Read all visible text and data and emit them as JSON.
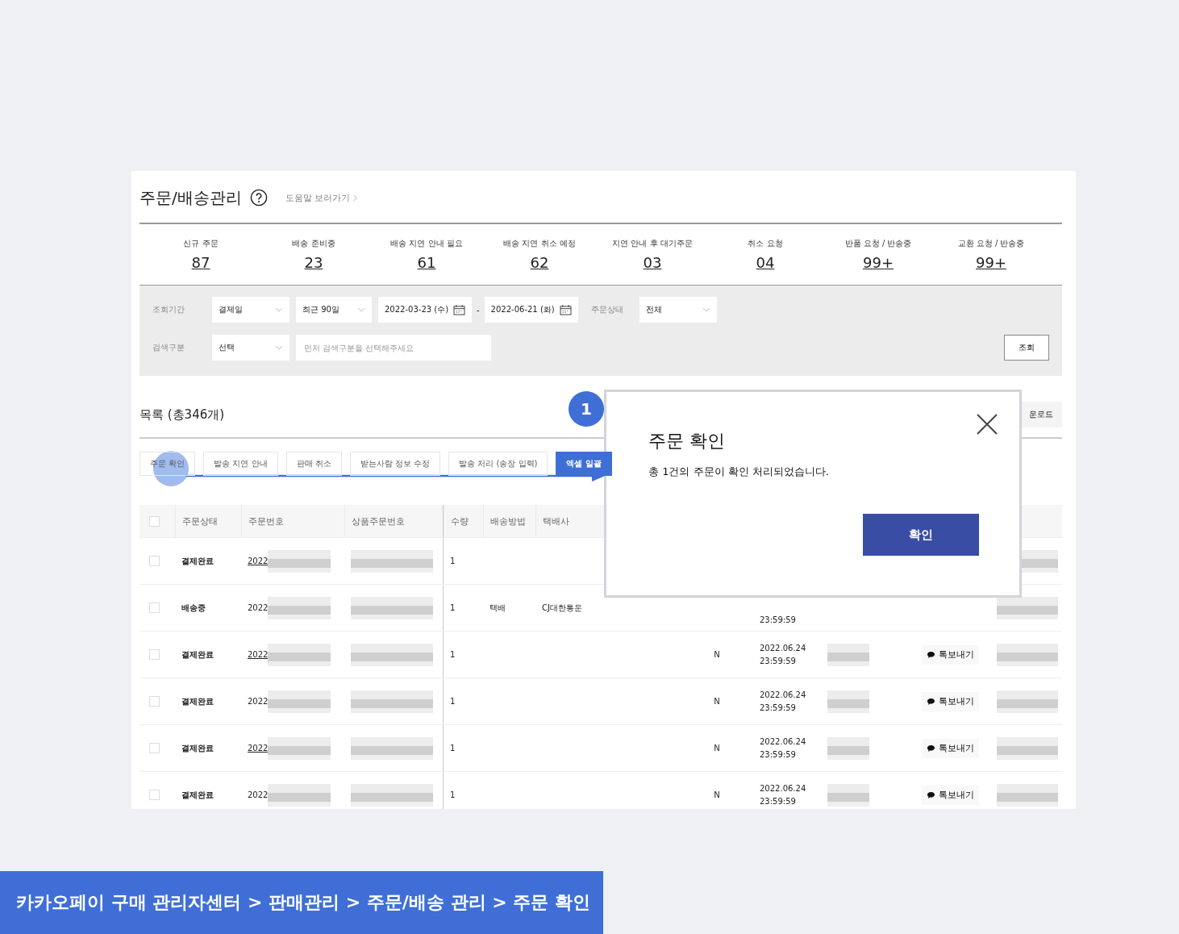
{
  "page": {
    "title": "주문/배송관리",
    "help_link": "도움말 보러가기"
  },
  "stats": [
    {
      "label": "신규 주문",
      "value": "87"
    },
    {
      "label": "배송 준비중",
      "value": "23"
    },
    {
      "label": "배송 지연 안내 필요",
      "value": "61"
    },
    {
      "label": "배송 지연 취소 예정",
      "value": "62"
    },
    {
      "label": "지연 안내 후 대기주문",
      "value": "03"
    },
    {
      "label": "취소 요청",
      "value": "04"
    },
    {
      "label": "반품 요청 / 반송중",
      "value": "99+"
    },
    {
      "label": "교환 요청 / 반송중",
      "value": "99+"
    }
  ],
  "filters": {
    "period_label": "조회기간",
    "date_type": "결제일",
    "range": "최근 90일",
    "start_date": "2022-03-23 (수)",
    "separator": "-",
    "end_date": "2022-06-21 (화)",
    "status_label": "주문상태",
    "status": "전체",
    "search_label": "검색구분",
    "search_type": "선택",
    "search_placeholder": "먼저 검색구분을 선택해주세요",
    "search_button": "조회"
  },
  "list": {
    "title": "목록 (총346개)",
    "download_button": "운로드"
  },
  "actions": [
    {
      "label": "주문 확인",
      "kind": "outline"
    },
    {
      "label": "발송 지연 안내",
      "kind": "outline"
    },
    {
      "label": "판매 취소",
      "kind": "outline"
    },
    {
      "label": "받는사람 정보 수정",
      "kind": "outline"
    },
    {
      "label": "발송 처리 (송장 입력)",
      "kind": "outline"
    },
    {
      "label": "엑셀 일괄 ",
      "kind": "primary"
    }
  ],
  "table": {
    "columns": [
      "주문상태",
      "주문번호",
      "상품주문번호",
      "수량",
      "배송방법",
      "택배사"
    ],
    "all_checked": false,
    "rows": [
      {
        "checked": false,
        "status": "결제완료",
        "order": "2022",
        "link": true,
        "qty": "1",
        "talk": null
      },
      {
        "checked": false,
        "status": "배송중",
        "order": "2022",
        "link": false,
        "qty": "1",
        "method": "택배",
        "courier": "CJ대한통운",
        "date_time": "23:59:59",
        "talk": null
      },
      {
        "checked": false,
        "status": "결제완료",
        "order": "2022",
        "link": true,
        "qty": "1",
        "flag": "N",
        "date": "2022.06.24",
        "time": "23:59:59",
        "talk": "톡보내기"
      },
      {
        "checked": false,
        "status": "결제완료",
        "order": "2022",
        "link": false,
        "qty": "1",
        "flag": "N",
        "date": "2022.06.24",
        "time": "23:59:59",
        "talk": "톡보내기"
      },
      {
        "checked": false,
        "status": "결제완료",
        "order": "2022",
        "link": true,
        "qty": "1",
        "flag": "N",
        "date": "2022.06.24",
        "time": "23:59:59",
        "talk": "톡보내기"
      },
      {
        "checked": false,
        "status": "결제완료",
        "order": "2022",
        "link": false,
        "qty": "1",
        "flag": "N",
        "date": "2022.06.24",
        "time": "23:59:59",
        "talk": "톡보내기"
      }
    ]
  },
  "dialog": {
    "title": "주문 확인",
    "message": "총 1건의 주문이 확인 처리되었습니다.",
    "confirm_button": "확인"
  },
  "guide": {
    "step": "1",
    "caption": "카카오페이 구매 관리자센터 > 판매관리 > 주문/배송 관리 > 주문 확인"
  }
}
